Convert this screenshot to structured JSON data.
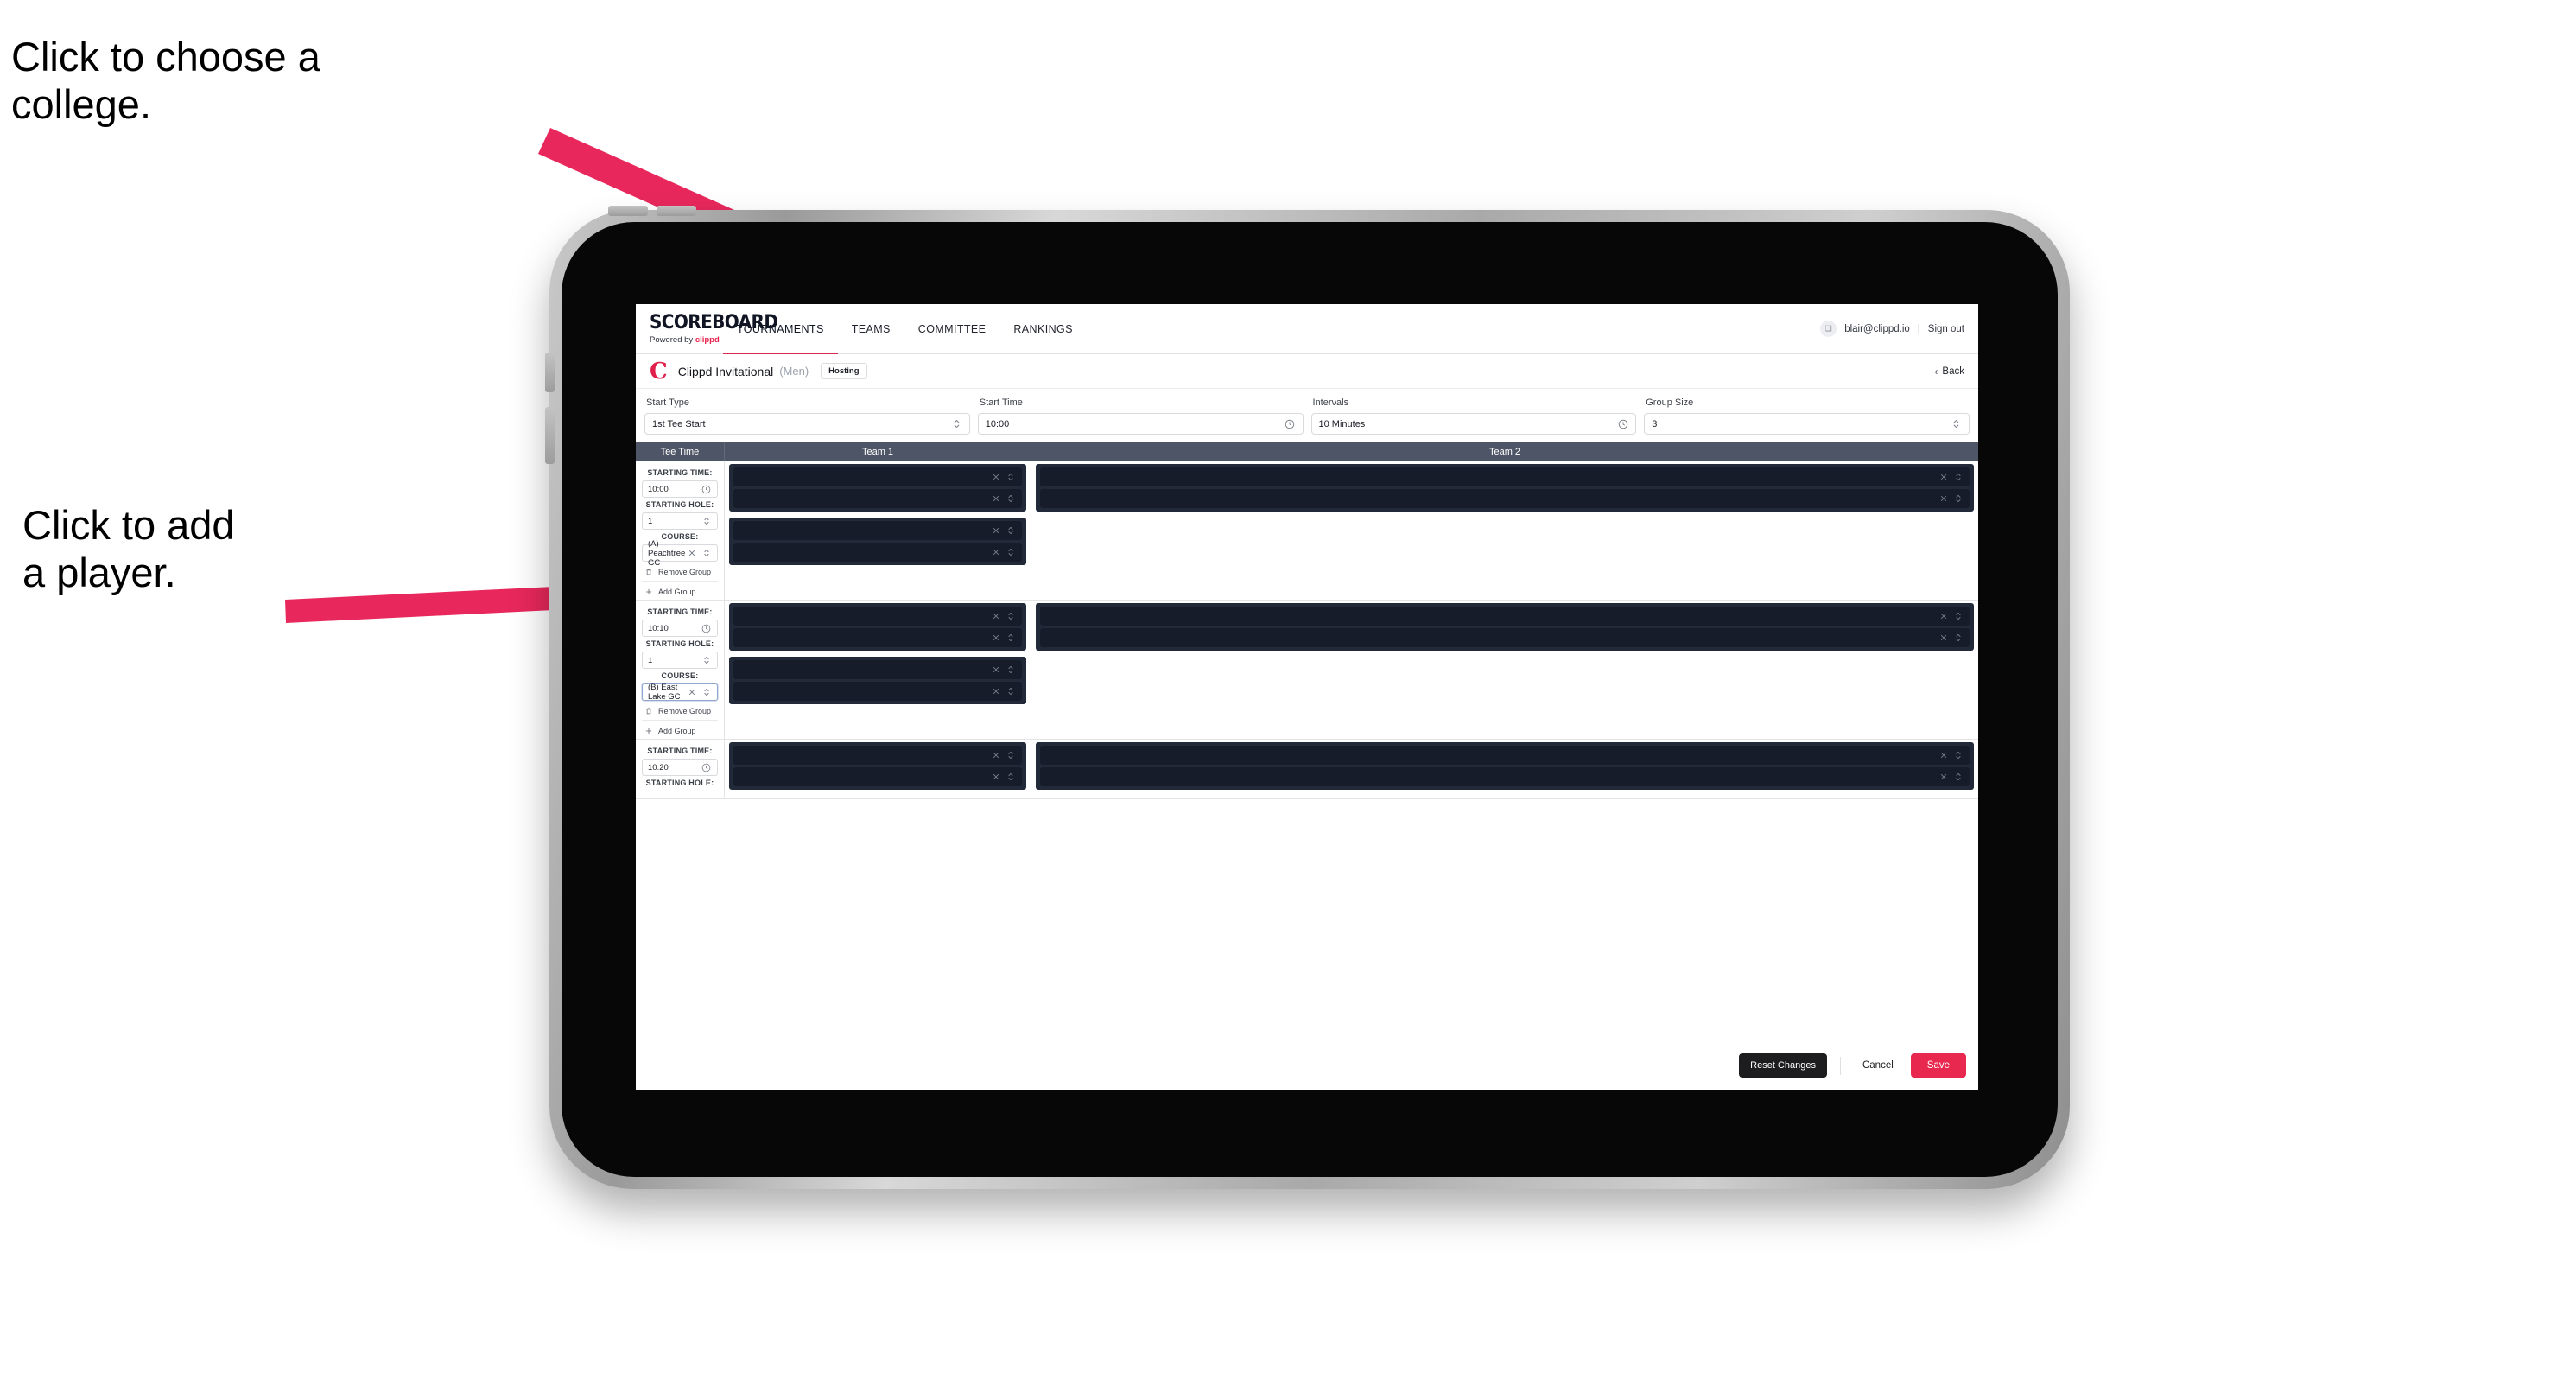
{
  "annotations": {
    "college": "Click to choose a\ncollege.",
    "player": "Click to add\na player."
  },
  "colors": {
    "accent_pink": "#e8284f",
    "arrow_pink": "#e8285c",
    "header_slate": "#4e5566",
    "slot_dark": "#222a39",
    "slot_row_dark": "#161c2a",
    "nav_active_underline": "#d32a4e"
  },
  "app": {
    "topnav": {
      "logo": {
        "wordmark": "SCOREBOARD",
        "tagline_prefix": "Powered by ",
        "tagline_brand": "clippd"
      },
      "items": [
        {
          "label": "TOURNAMENTS",
          "active": true
        },
        {
          "label": "TEAMS",
          "active": false
        },
        {
          "label": "COMMITTEE",
          "active": false
        },
        {
          "label": "RANKINGS",
          "active": false
        }
      ],
      "user": {
        "avatar_glyph": "❑",
        "email": "blair@clippd.io",
        "separator": "|",
        "sign_out": "Sign out"
      }
    },
    "tournament": {
      "brand_mark": "C",
      "name": "Clippd Invitational",
      "gender": "(Men)",
      "badge": "Hosting",
      "back_label": "Back",
      "back_chevron": "‹"
    },
    "settings": [
      {
        "label": "Start Type",
        "value": "1st Tee Start",
        "icon": "stepper-icon"
      },
      {
        "label": "Start Time",
        "value": "10:00",
        "icon": "clock-icon"
      },
      {
        "label": "Intervals",
        "value": "10 Minutes",
        "icon": "clock-icon"
      },
      {
        "label": "Group Size",
        "value": "3",
        "icon": "stepper-icon"
      }
    ],
    "grid": {
      "headers": [
        "Tee Time",
        "Team 1",
        "Team 2"
      ],
      "field_labels": {
        "starting_time": "STARTING TIME:",
        "starting_hole": "STARTING HOLE:",
        "course": "COURSE:"
      },
      "actions": {
        "remove_group": "Remove Group",
        "add_group": "Add Group",
        "remove_icon": "trash-icon",
        "add_icon": "plus-icon"
      },
      "rows": [
        {
          "starting_time": "10:00",
          "starting_hole": "1",
          "course": "(A) Peachtree GC",
          "course_focused": false,
          "team1": [
            {
              "players": [
                "",
                ""
              ]
            },
            {
              "players": [
                "",
                ""
              ]
            }
          ],
          "team2": [
            {
              "players": [
                "",
                ""
              ]
            }
          ]
        },
        {
          "starting_time": "10:10",
          "starting_hole": "1",
          "course": "(B) East Lake GC",
          "course_focused": true,
          "team1": [
            {
              "players": [
                "",
                ""
              ]
            },
            {
              "players": [
                "",
                ""
              ]
            }
          ],
          "team2": [
            {
              "players": [
                "",
                ""
              ]
            }
          ]
        },
        {
          "starting_time": "10:20",
          "starting_hole": "",
          "course": "",
          "course_focused": false,
          "team1": [
            {
              "players": [
                "",
                ""
              ]
            }
          ],
          "team2": [
            {
              "players": [
                "",
                ""
              ]
            }
          ]
        }
      ],
      "slot_icons": {
        "clear": "×",
        "reorder": "stepper-icon"
      }
    },
    "footer": {
      "reset": "Reset Changes",
      "cancel": "Cancel",
      "save": "Save"
    }
  }
}
